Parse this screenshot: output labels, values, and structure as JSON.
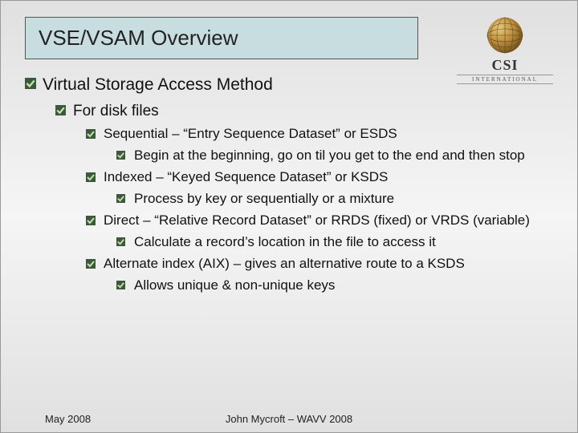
{
  "title": "VSE/VSAM Overview",
  "logo": {
    "brand": "CSI",
    "sub": "International"
  },
  "content": {
    "l1": "Virtual Storage Access Method",
    "l2": "For disk files",
    "seq": {
      "head": "Sequential – “Entry Sequence Dataset” or ESDS",
      "sub": "Begin at the beginning, go on til you get to the end and then stop"
    },
    "idx": {
      "head": "Indexed – “Keyed Sequence Dataset” or KSDS",
      "sub": "Process by key or sequentially or a mixture"
    },
    "dir": {
      "head": "Direct – “Relative Record Dataset” or RRDS (fixed) or VRDS (variable)",
      "sub": "Calculate a record’s location in the file to access it"
    },
    "aix": {
      "head": "Alternate index (AIX) – gives an alternative route to a KSDS",
      "sub": "Allows unique & non-unique keys"
    }
  },
  "footer": {
    "left": "May 2008",
    "center": "John Mycroft – WAVV 2008"
  }
}
